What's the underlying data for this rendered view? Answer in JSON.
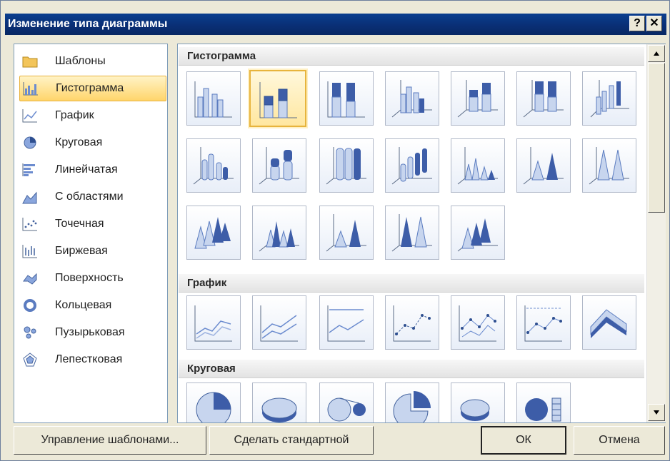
{
  "window": {
    "title": "Изменение типа диаграммы",
    "help_label": "?",
    "close_label": "✕"
  },
  "categories": [
    {
      "label": "Шаблоны",
      "icon": "folder-icon"
    },
    {
      "label": "Гистограмма",
      "icon": "column-chart-icon",
      "selected": true
    },
    {
      "label": "График",
      "icon": "line-chart-icon"
    },
    {
      "label": "Круговая",
      "icon": "pie-chart-icon"
    },
    {
      "label": "Линейчатая",
      "icon": "bar-chart-icon"
    },
    {
      "label": "С областями",
      "icon": "area-chart-icon"
    },
    {
      "label": "Точечная",
      "icon": "scatter-chart-icon"
    },
    {
      "label": "Биржевая",
      "icon": "stock-chart-icon"
    },
    {
      "label": "Поверхность",
      "icon": "surface-chart-icon"
    },
    {
      "label": "Кольцевая",
      "icon": "doughnut-chart-icon"
    },
    {
      "label": "Пузырьковая",
      "icon": "bubble-chart-icon"
    },
    {
      "label": "Лепестковая",
      "icon": "radar-chart-icon"
    }
  ],
  "gallery": {
    "sections": [
      {
        "title": "Гистограмма"
      },
      {
        "title": "График"
      },
      {
        "title": "Круговая"
      }
    ]
  },
  "buttons": {
    "manage_templates": "Управление шаблонами...",
    "set_default": "Сделать стандартной",
    "ok": "ОК",
    "cancel": "Отмена"
  }
}
